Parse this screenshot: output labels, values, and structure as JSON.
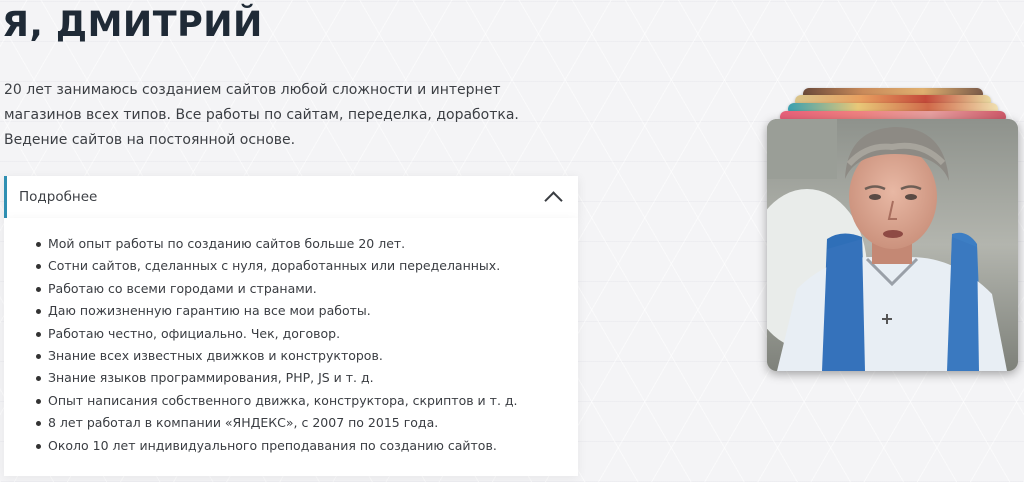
{
  "heading": "Я, ДМИТРИЙ",
  "intro": "20 лет занимаюсь созданием сайтов любой сложности и интернет магазинов всех типов. Все работы по сайтам, переделка, доработка. Ведение сайтов на постоянной основе.",
  "accordion": {
    "label": "Подробнее",
    "state": "expanded",
    "icon": "chevron-up-icon",
    "items": [
      "Мой опыт работы по созданию сайтов больше 20 лет.",
      "Сотни сайтов, сделанных с нуля, доработанных или переделанных.",
      "Работаю со всеми городами и странами.",
      "Даю пожизненную гарантию на все мои работы.",
      "Работаю честно, официально. Чек, договор.",
      "Знание всех известных движков и конструкторов.",
      "Знание языков программирования, PHP, JS и т. д.",
      "Опыт написания собственного движка, конструктора, скриптов и т. д.",
      "8 лет работал в компании «ЯНДЕКС», с 2007 по 2015 года.",
      "Около 10 лет индивидуального преподавания по созданию сайтов."
    ]
  },
  "colors": {
    "accent": "#2f8fb2",
    "heading": "#1f2a36",
    "text": "#3a3d42",
    "background": "#f4f4f6"
  }
}
